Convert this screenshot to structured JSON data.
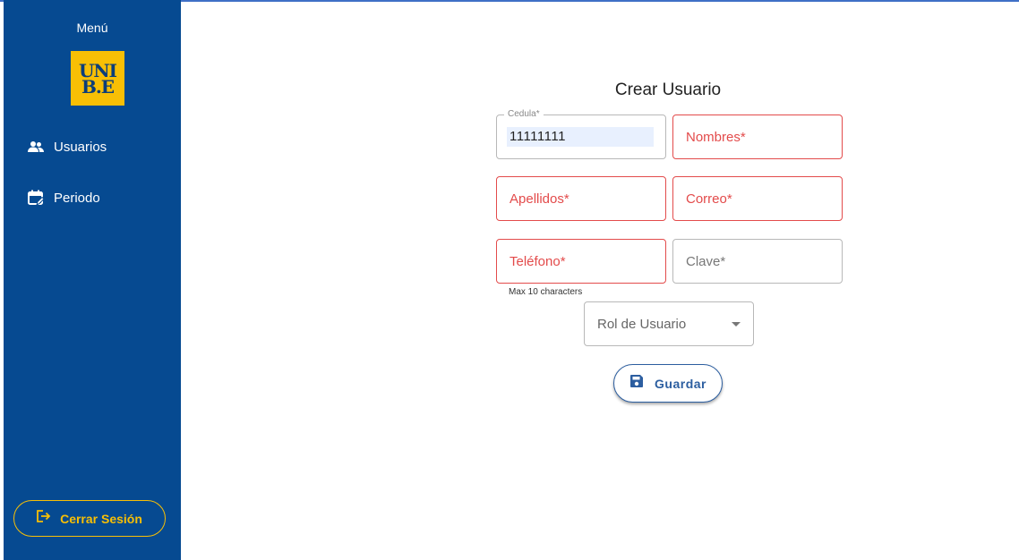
{
  "sidebar": {
    "title": "Menú",
    "logo": {
      "line1": "UNI",
      "line2": "B.E"
    },
    "items": [
      {
        "label": "Usuarios",
        "icon": "group-icon"
      },
      {
        "label": "Periodo",
        "icon": "calendar-edit-icon"
      }
    ],
    "logout_label": "Cerrar Sesión",
    "colors": {
      "background": "#064a91",
      "accent": "#f8bf05"
    }
  },
  "form": {
    "title": "Crear Usuario",
    "cedula": {
      "label": "Cedula*",
      "value": "11111111"
    },
    "nombres": {
      "placeholder": "Nombres*"
    },
    "apellidos": {
      "placeholder": "Apellidos*"
    },
    "correo": {
      "placeholder": "Correo*"
    },
    "telefono": {
      "placeholder": "Teléfono*",
      "helper": "Max 10 characters"
    },
    "clave": {
      "placeholder": "Clave*"
    },
    "rol": {
      "placeholder": "Rol de Usuario"
    },
    "save_label": "Guardar",
    "colors": {
      "error": "#e34b4b",
      "primary": "#2c5ea0"
    }
  }
}
